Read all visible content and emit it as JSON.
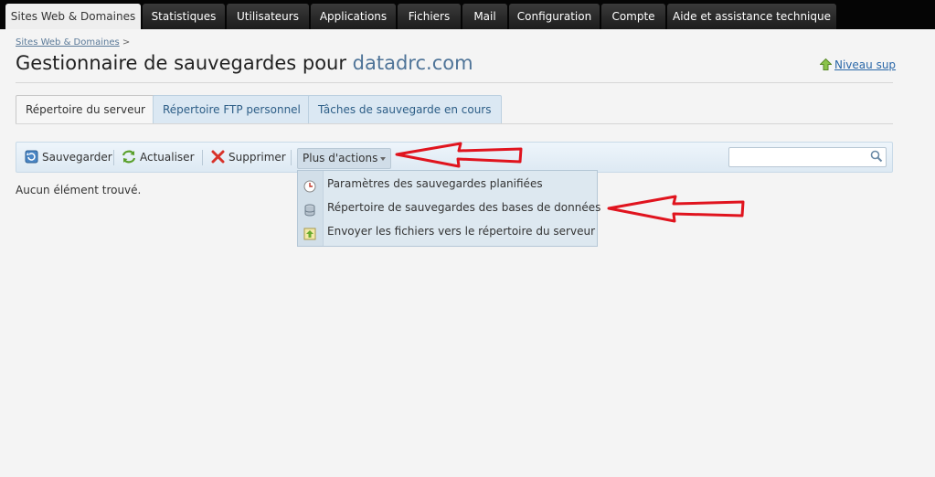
{
  "topnav": {
    "tabs": [
      {
        "label": "Sites Web & Domaines",
        "active": true
      },
      {
        "label": "Statistiques"
      },
      {
        "label": "Utilisateurs"
      },
      {
        "label": "Applications"
      },
      {
        "label": "Fichiers"
      },
      {
        "label": "Mail"
      },
      {
        "label": "Configuration"
      },
      {
        "label": "Compte"
      },
      {
        "label": "Aide et assistance technique"
      }
    ]
  },
  "breadcrumb": {
    "link": "Sites Web & Domaines",
    "separator": ">"
  },
  "page": {
    "title_prefix": "Gestionnaire de sauvegardes pour",
    "domain": "datadrc.com",
    "up_level": "Niveau sup"
  },
  "subtabs": [
    {
      "label": "Répertoire du serveur",
      "active": true
    },
    {
      "label": "Répertoire FTP personnel"
    },
    {
      "label": "Tâches de sauvegarde en cours"
    }
  ],
  "toolbar": {
    "backup": "Sauvegarder",
    "refresh": "Actualiser",
    "delete": "Supprimer",
    "more": "Plus d'actions",
    "search_value": ""
  },
  "empty_message": "Aucun élément trouvé.",
  "more_menu": {
    "items": [
      {
        "label": "Paramètres des sauvegardes planifiées",
        "icon": "clock-icon"
      },
      {
        "label": "Répertoire de sauvegardes des bases de données",
        "icon": "database-icon"
      },
      {
        "label": "Envoyer les fichiers vers le répertoire du serveur",
        "icon": "upload-icon"
      }
    ]
  },
  "colors": {
    "annotation_arrow": "#e0141e",
    "link": "#2a67a8",
    "domain": "#4f7498"
  }
}
